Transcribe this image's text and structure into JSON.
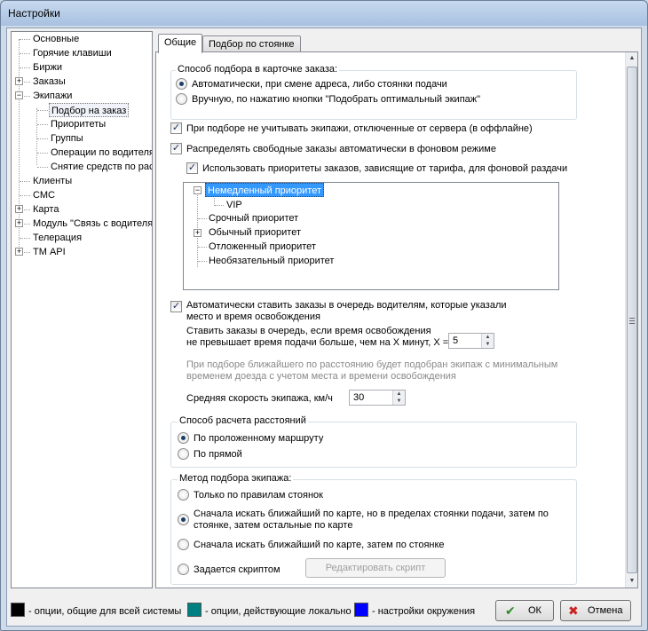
{
  "window": {
    "title": "Настройки"
  },
  "tree": {
    "items": [
      {
        "label": "Основные",
        "level": 0,
        "expandable": false
      },
      {
        "label": "Горячие клавиши",
        "level": 0,
        "expandable": false
      },
      {
        "label": "Биржи",
        "level": 0,
        "expandable": false
      },
      {
        "label": "Заказы",
        "level": 0,
        "expandable": true,
        "expanded": false
      },
      {
        "label": "Экипажи",
        "level": 0,
        "expandable": true,
        "expanded": true
      },
      {
        "label": "Подбор на заказ",
        "level": 1,
        "expandable": false,
        "selected": true
      },
      {
        "label": "Приоритеты",
        "level": 1,
        "expandable": false
      },
      {
        "label": "Группы",
        "level": 1,
        "expandable": false
      },
      {
        "label": "Операции по водителя",
        "level": 1,
        "expandable": false
      },
      {
        "label": "Снятие средств по рас",
        "level": 1,
        "expandable": false
      },
      {
        "label": "Клиенты",
        "level": 0,
        "expandable": false
      },
      {
        "label": "СМС",
        "level": 0,
        "expandable": false
      },
      {
        "label": "Карта",
        "level": 0,
        "expandable": true,
        "expanded": false
      },
      {
        "label": "Модуль \"Связь с водителя",
        "level": 0,
        "expandable": true,
        "expanded": false
      },
      {
        "label": "Телерация",
        "level": 0,
        "expandable": false
      },
      {
        "label": "ТМ API",
        "level": 0,
        "expandable": true,
        "expanded": false
      }
    ]
  },
  "tabs": [
    {
      "label": "Общие",
      "active": true
    },
    {
      "label": "Подбор по стоянке",
      "active": false
    }
  ],
  "selection_method": {
    "title": "Способ подбора в карточке заказа:",
    "options": [
      {
        "label": "Автоматически, при смене адреса, либо стоянки подачи",
        "checked": true
      },
      {
        "label": "Вручную, по нажатию кнопки \"Подобрать оптимальный экипаж\"",
        "checked": false
      }
    ]
  },
  "checks": {
    "ignore_offline": {
      "label": "При подборе не учитывать экипажи, отключенные от сервера (в оффлайне)",
      "checked": true
    },
    "auto_distribute": {
      "label": "Распределять свободные заказы автоматически в фоновом режиме",
      "checked": true
    },
    "use_priorities": {
      "label": "Использовать приоритеты заказов, зависящие от тарифа, для фоновой раздачи",
      "checked": true
    },
    "auto_queue": {
      "label_line1": "Автоматически ставить заказы в очередь водителям, которые указали",
      "label_line2": "место и время освобождения",
      "checked": true
    }
  },
  "priorities": {
    "items": [
      {
        "label": "Немедленный приоритет",
        "level": 0,
        "expandable": true,
        "expanded": true,
        "selected": true
      },
      {
        "label": "VIP",
        "level": 1
      },
      {
        "label": "Срочный приоритет",
        "level": 0
      },
      {
        "label": "Обычный приоритет",
        "level": 0,
        "expandable": true,
        "expanded": false
      },
      {
        "label": "Отложенный приоритет",
        "level": 0
      },
      {
        "label": "Необязательный приоритет",
        "level": 0
      }
    ]
  },
  "queue": {
    "line1": "Ставить заказы в очередь, если время освобождения",
    "line2": "не превышает время подачи больше, чем на X минут, X =",
    "x_value": "5",
    "note_line1": "При подборе ближайшего по расстоянию будет подобран экипаж с минимальным",
    "note_line2": "временем доезда с учетом места и времени освобождения",
    "speed_label": "Средняя скорость экипажа, км/ч",
    "speed_value": "30"
  },
  "distance_method": {
    "title": "Способ расчета расстояний",
    "options": [
      {
        "label": "По проложенному маршруту",
        "checked": true
      },
      {
        "label": "По прямой",
        "checked": false
      }
    ]
  },
  "crew_method": {
    "title": "Метод подбора экипажа:",
    "options": [
      {
        "label": "Только по правилам стоянок",
        "checked": false
      },
      {
        "label_line1": "Сначала искать ближайший по карте, но в пределах стоянки подачи, затем по",
        "label_line2": "стоянке, затем остальные по карте",
        "checked": true
      },
      {
        "label": "Сначала искать ближайший по карте, затем по стоянке",
        "checked": false
      },
      {
        "label": "Задается скриптом",
        "checked": false
      }
    ],
    "edit_script_label": "Редактировать скрипт"
  },
  "legend": {
    "items": [
      {
        "label": "- опции, общие для всей системы",
        "color": "#000000"
      },
      {
        "label": "- опции, действующие локально",
        "color": "#008080"
      },
      {
        "label": "- настройки окружения",
        "color": "#0000ff"
      }
    ]
  },
  "buttons": {
    "ok": "ОК",
    "cancel": "Отмена"
  },
  "colors": {
    "accent_selection": "#3399ff",
    "ok_check": "#2e8b22",
    "cancel_x": "#cc2222"
  }
}
